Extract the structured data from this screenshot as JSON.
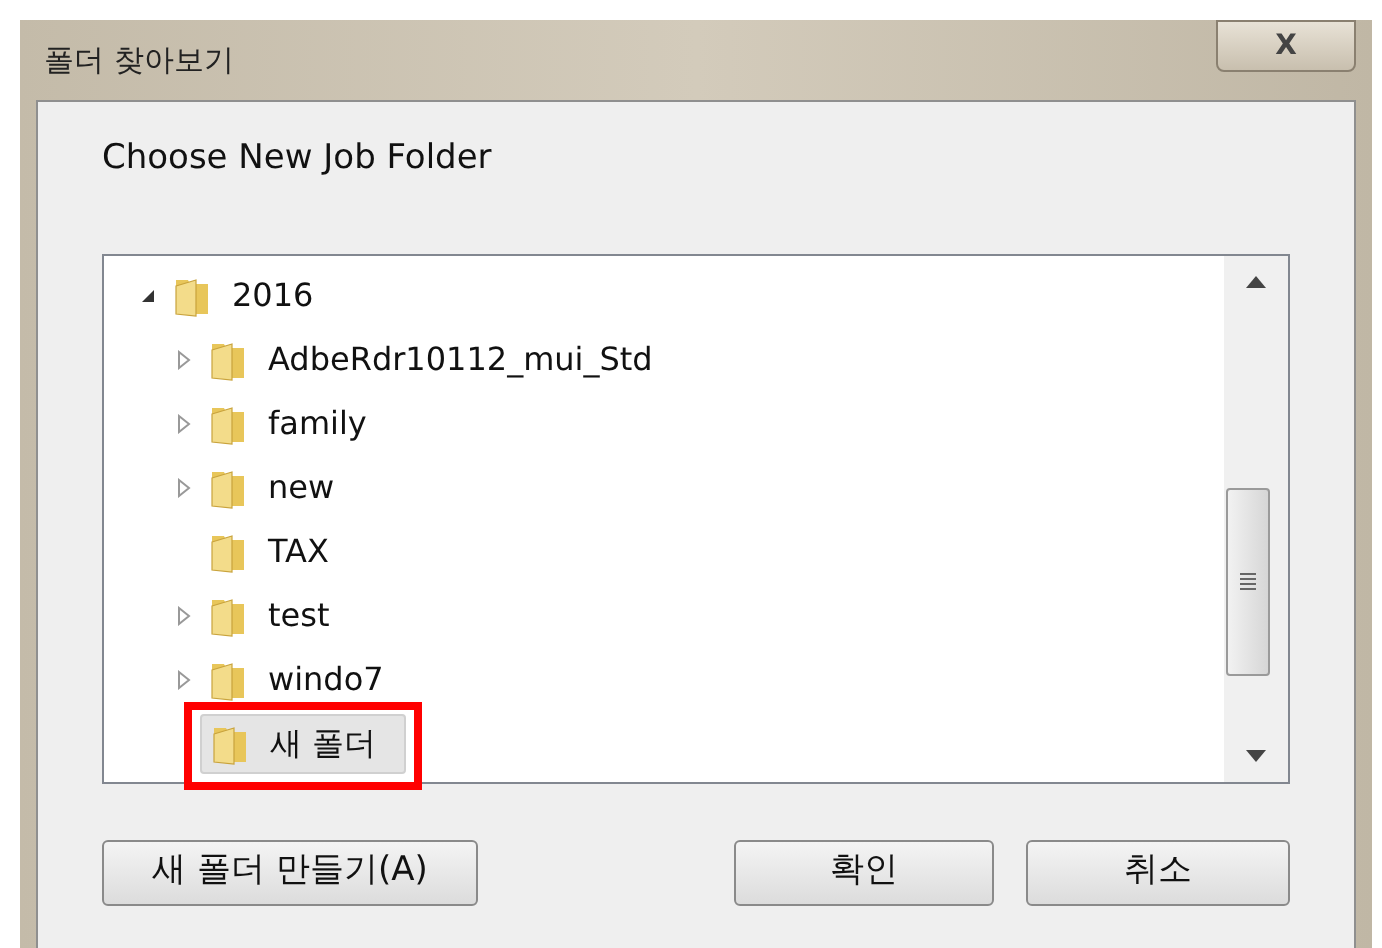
{
  "window": {
    "title": "폴더 찾아보기",
    "close": "X"
  },
  "prompt": "Choose New Job Folder",
  "tree": [
    {
      "label": "2016",
      "kind": "expanded",
      "selected": false,
      "highlighted": false,
      "children": [
        {
          "label": "AdbeRdr10112_mui_Std",
          "kind": "collapsed",
          "selected": false,
          "highlighted": false
        },
        {
          "label": "family",
          "kind": "collapsed",
          "selected": false,
          "highlighted": false
        },
        {
          "label": "new",
          "kind": "collapsed",
          "selected": false,
          "highlighted": false
        },
        {
          "label": "TAX",
          "kind": "leaf",
          "selected": false,
          "highlighted": false
        },
        {
          "label": "test",
          "kind": "collapsed",
          "selected": false,
          "highlighted": false
        },
        {
          "label": "windo7",
          "kind": "collapsed",
          "selected": false,
          "highlighted": false
        },
        {
          "label": "새 폴더",
          "kind": "leaf",
          "selected": true,
          "highlighted": true
        }
      ]
    }
  ],
  "buttons": {
    "new_folder": "새 폴더 만들기(A)",
    "ok": "확인",
    "cancel": "취소"
  }
}
